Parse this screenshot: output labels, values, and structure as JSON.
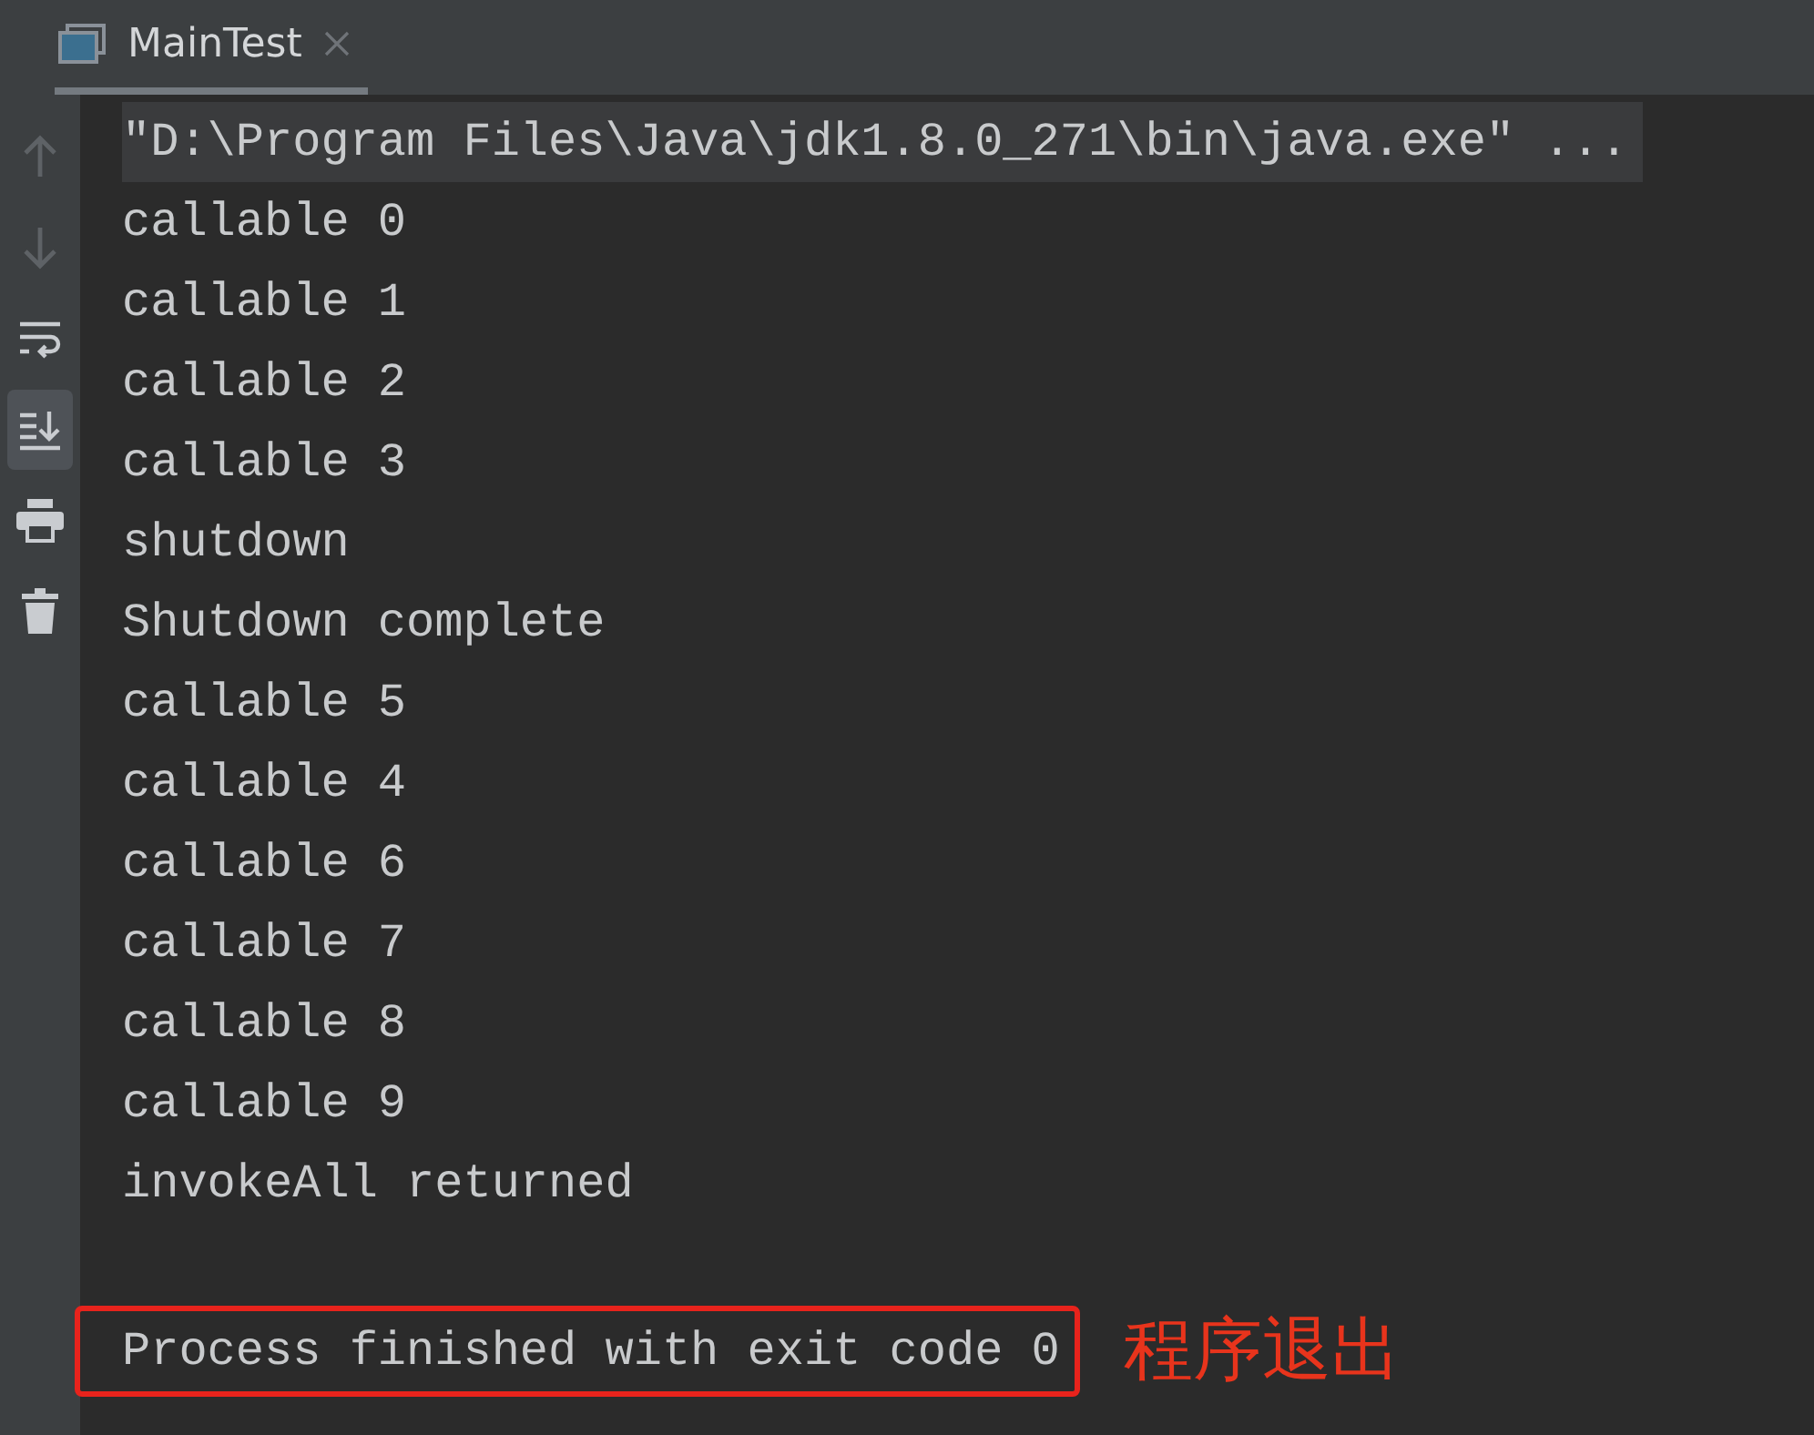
{
  "tab": {
    "title": "MainTest",
    "selected": true
  },
  "toolbar": [
    {
      "kind": "up",
      "disabled": true,
      "selected": false
    },
    {
      "kind": "down",
      "disabled": true,
      "selected": false
    },
    {
      "kind": "wrap",
      "disabled": false,
      "selected": false
    },
    {
      "kind": "scroll",
      "disabled": false,
      "selected": true
    },
    {
      "kind": "print",
      "disabled": false,
      "selected": false
    },
    {
      "kind": "trash",
      "disabled": false,
      "selected": false
    }
  ],
  "console": {
    "command": "\"D:\\Program Files\\Java\\jdk1.8.0_271\\bin\\java.exe\" ...",
    "lines": [
      "callable 0",
      "callable 1",
      "callable 2",
      "callable 3",
      "shutdown",
      "Shutdown complete",
      "callable 5",
      "callable 4",
      "callable 6",
      "callable 7",
      "callable 8",
      "callable 9",
      "invokeAll returned"
    ],
    "exit_message": "Process finished with exit code 0"
  },
  "annotation": {
    "label": "程序退出"
  }
}
